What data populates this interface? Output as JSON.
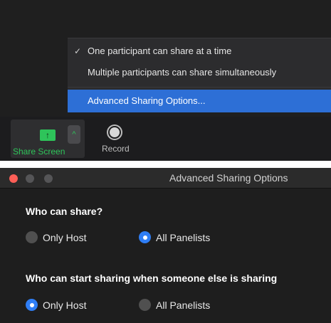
{
  "share_menu": {
    "items": [
      {
        "label": "One participant can share at a time",
        "checked": true
      },
      {
        "label": "Multiple participants can share simultaneously",
        "checked": false
      }
    ],
    "check_mark": "✓",
    "advanced_label": "Advanced Sharing Options..."
  },
  "toolbar": {
    "share_screen_label": "Share Screen",
    "share_icon": "↑",
    "caret_icon": "^",
    "record_label": "Record"
  },
  "dialog": {
    "title": "Advanced Sharing Options",
    "q1": {
      "heading": "Who can share?",
      "options": [
        {
          "label": "Only Host",
          "selected": false
        },
        {
          "label": "All Panelists",
          "selected": true
        }
      ]
    },
    "q2": {
      "heading": "Who can start sharing when someone else is sharing",
      "options": [
        {
          "label": "Only Host",
          "selected": true
        },
        {
          "label": "All Panelists",
          "selected": false
        }
      ]
    }
  },
  "colors": {
    "highlight": "#2d6fd6",
    "share_green": "#2ec45a",
    "radio_selected": "#2f7ef5",
    "close_button": "#fe5f57"
  }
}
